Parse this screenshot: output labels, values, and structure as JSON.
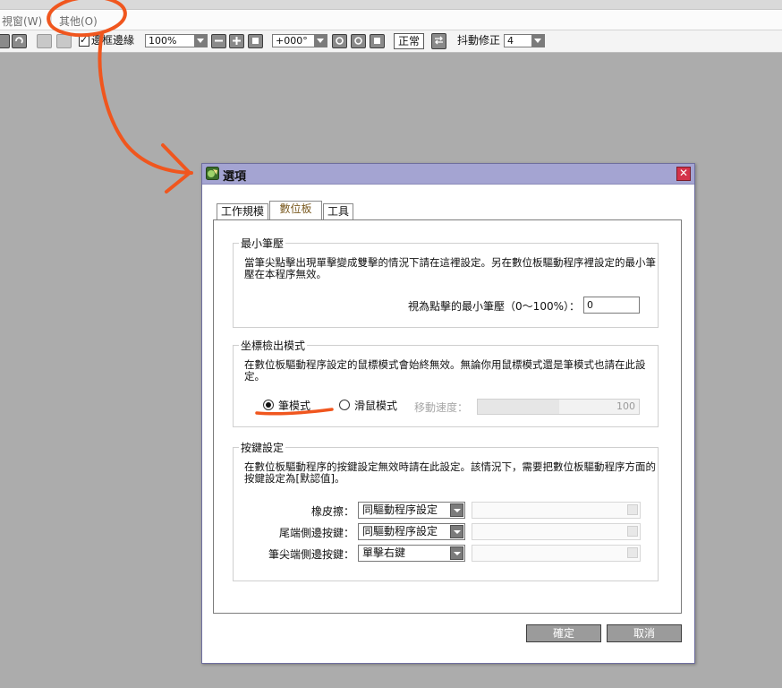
{
  "menubar": {
    "items": [
      {
        "label": "視窗(W)"
      },
      {
        "label": "其他(O)"
      }
    ]
  },
  "toolbar": {
    "edge_checkbox_label": "邊框邊緣",
    "zoom_value": "100%",
    "rotation_value": "+000°",
    "normal_label": "正常",
    "stabilizer_label": "抖動修正",
    "stabilizer_value": "4"
  },
  "dialog": {
    "title": "選項",
    "tabs": [
      {
        "label": "工作規模"
      },
      {
        "label": "數位板"
      },
      {
        "label": "工具"
      }
    ],
    "min_pressure": {
      "title": "最小筆壓",
      "description": "當筆尖點擊出現單擊變成雙擊的情況下請在這裡設定。另在數位板驅動程序裡設定的最小筆壓在本程序無效。",
      "field_label": "視為點擊的最小筆壓（0〜100%）：",
      "field_value": "0"
    },
    "coord_mode": {
      "title": "坐標檢出模式",
      "description": "在數位板驅動程序設定的鼠標模式會始終無效。無論你用鼠標模式還是筆模式也請在此設定。",
      "pen_mode_label": "筆模式",
      "mouse_mode_label": "滑鼠模式",
      "move_speed_label": "移動速度：",
      "move_speed_value": "100"
    },
    "button_settings": {
      "title": "按鍵設定",
      "description": "在數位板驅動程序的按鍵設定無效時請在此設定。該情況下，需要把數位板驅動程序方面的按鍵設定為[默認值]。",
      "rows": [
        {
          "label": "橡皮擦：",
          "value": "同驅動程序設定"
        },
        {
          "label": "尾端側邊按鍵：",
          "value": "同驅動程序設定"
        },
        {
          "label": "筆尖端側邊按鍵：",
          "value": "單擊右鍵"
        }
      ]
    },
    "ok_label": "確定",
    "cancel_label": "取消"
  },
  "colors": {
    "annotation": "#f0561e",
    "titlebar": "#a4a4d2",
    "close": "#d4324a"
  }
}
